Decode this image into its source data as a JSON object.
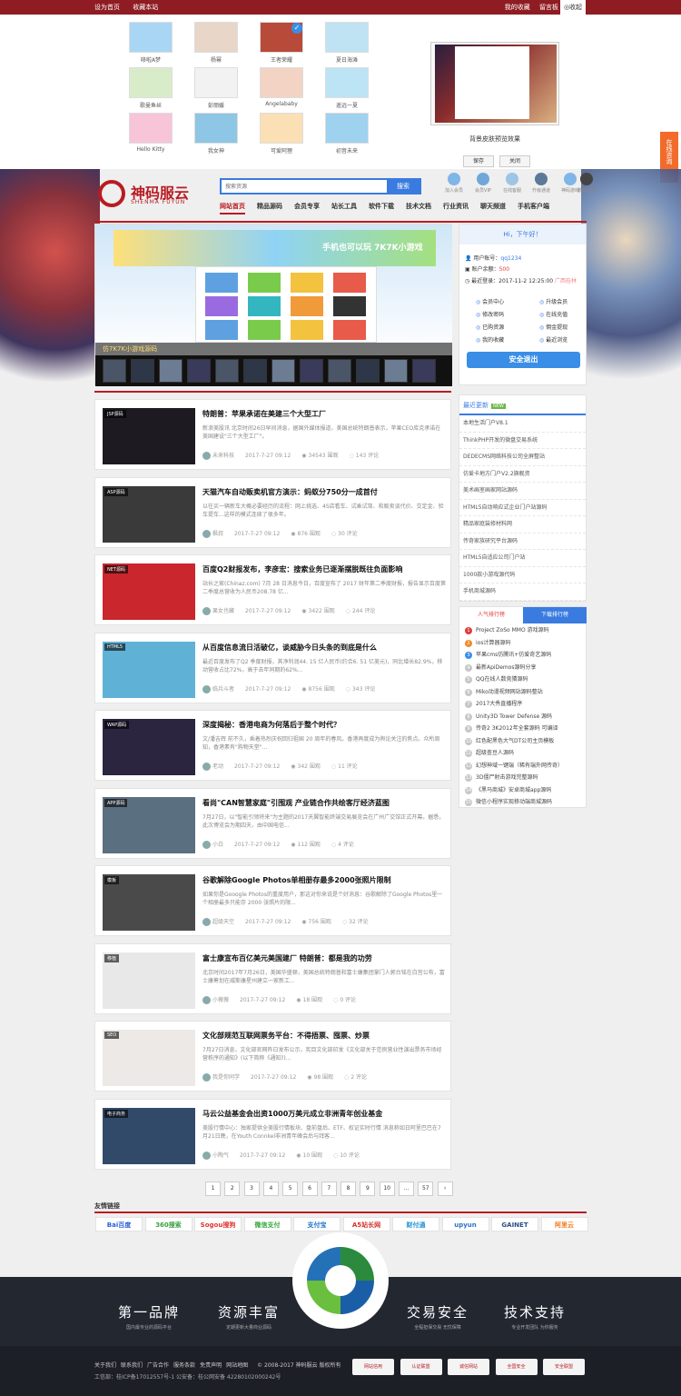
{
  "topbar": {
    "set_home": "设为首页",
    "favorite": "收藏本站",
    "my_favorites": "我的收藏",
    "guestbook": "留言板",
    "fold": "收起"
  },
  "skins": [
    {
      "name": "哆啦A梦",
      "color": "#a9d6f5"
    },
    {
      "name": "杨幂",
      "color": "#e8d6c9"
    },
    {
      "name": "王者荣耀",
      "color": "#b84a3a"
    },
    {
      "name": "夏日海滩",
      "color": "#bfe3f2"
    },
    {
      "name": "歌曼鱼丝",
      "color": "#d9ecc9"
    },
    {
      "name": "彭丽媛",
      "color": "#f2f2f2"
    },
    {
      "name": "Angelababy",
      "color": "#f3d4c4"
    },
    {
      "name": "遥远一夏",
      "color": "#bde4f4"
    },
    {
      "name": "Hello Kitty",
      "color": "#f7c5d7"
    },
    {
      "name": "我女神",
      "color": "#8ec6e6"
    },
    {
      "name": "可爱阿狸",
      "color": "#fbe0b5"
    },
    {
      "name": "初音未来",
      "color": "#9fd2ee"
    }
  ],
  "preview": {
    "caption": "背景皮肤预览效果",
    "save": "保存",
    "close": "关闭"
  },
  "online_consult": "在线咨询",
  "logo": {
    "cn": "神码服云",
    "en": "SHENMA FUYUN"
  },
  "search": {
    "placeholder": "搜索资源",
    "button": "搜索"
  },
  "quick_links": [
    {
      "label": "加入会员",
      "color": "#7fb6e8"
    },
    {
      "label": "会员VIP",
      "color": "#6fa8d8"
    },
    {
      "label": "在线客服",
      "color": "#9ec4e6"
    },
    {
      "label": "升级通道",
      "color": "#5c7a98"
    },
    {
      "label": "神码游戏",
      "color": "#7fb6e8"
    },
    {
      "label": "鹏程资源",
      "color": "#444444"
    }
  ],
  "nav": [
    "网站首页",
    "精品源码",
    "会员专享",
    "站长工具",
    "软件下载",
    "技术文档",
    "行业资讯",
    "聊天频道",
    "手机客户端"
  ],
  "slider": {
    "caption": "仿7K7K小游戏源码",
    "banner": "手机也可以玩 7K7K小游戏"
  },
  "user": {
    "greeting": "Hi，下午好！",
    "account_label": "用户账号：",
    "account": "qq1234",
    "balance_label": "账户余额：",
    "balance": "500",
    "last_login_label": "最近登录：",
    "last_login": "2017-11-2 12:25:00",
    "location": "广西桂林",
    "links": [
      "会员中心",
      "升级会员",
      "修改密码",
      "在线充值",
      "已购资源",
      "佣金提现",
      "我的收藏",
      "最近浏览"
    ],
    "logout": "安全退出"
  },
  "posts": [
    {
      "tag": "JSP源码",
      "title": "特朗普：苹果承诺在美建三个大型工厂",
      "desc": "新浪美股讯 北京时间26日早间消息，据国外媒体报道，美国总统特朗普表示，苹果CEO库克承诺在美国建设\"三个大型工厂\"。",
      "author": "未来科技",
      "date": "2017-7-27 09:12",
      "views": "34543 围观",
      "comments": "143 评论",
      "color": "#1d1a22"
    },
    {
      "tag": "ASP源码",
      "title": "天猫汽车自动贩卖机官方演示：蚂蚁分750分一成首付",
      "desc": "以往买一辆新车大概必要经历的流程：网上挑选、4S店看车、试乘试驾、和贩卖谈代价、交定金、验车提车...这样的模式连续了很多年。",
      "author": "枫叔",
      "date": "2017-7-27 09:12",
      "views": "876 围观",
      "comments": "30 评论",
      "color": "#3a3a3a"
    },
    {
      "tag": "NET源码",
      "title": "百度Q2财报发布，李彦宏：搜索业务已逐渐摆脱既往负面影响",
      "desc": "站长之家(Chinaz.com) 7月 28 日消息今日，百度宣布了 2017 财年第二季度财报，报告显示百度第二季度总营收为人民币208.78 亿...",
      "author": "果女也藏",
      "date": "2017-7-27 09:12",
      "views": "3422 围观",
      "comments": "244 评论",
      "color": "#c9262d"
    },
    {
      "tag": "HTML5",
      "title": "从百度信息流日活破亿，谈威胁今日头条的到底是什么",
      "desc": "最近百度发布了Q2 季度财报，其净利润44. 15 亿人民币(约合6. 51 亿美元)，同比增长82.9%，移动营收占比72%，高于去年同期的62%...",
      "author": "临兵斗者",
      "date": "2017-7-27 09:12",
      "views": "8756 围观",
      "comments": "343 评论",
      "color": "#5fb2d6"
    },
    {
      "tag": "WAP源码",
      "title": "深度揭秘：香港电商为何落后于整个时代？",
      "desc": "文/潘吉辉     前不久，乘着热烈庆祝回归祖国 20 周年的春风，香港再度成为舆论关注的焦点。众所周知，香港素有\"购物天堂\"...",
      "author": "老动",
      "date": "2017-7-27 09:12",
      "views": "342 围观",
      "comments": "11 评论",
      "color": "#2b2540"
    },
    {
      "tag": "APP源码",
      "title": "看尚\"CAN智慧家庭\"引围观 产业链合作共绘客厅经济蓝图",
      "desc": "7月27日，以\"智能引领将来\"为主题的2017天翼智能终端交易展览会在广州广交馆正式开幕。据悉，此次博览会为期四天，由中国电信...",
      "author": "小白",
      "date": "2017-7-27 09:12",
      "views": "112 围观",
      "comments": "4 评论",
      "color": "#5a6f80"
    },
    {
      "tag": "模板",
      "title": "谷歌解除Google Photos单相册存最多2000张照片限制",
      "desc": "如果你是Gooogle Photos的重度用户，那这对你来说是个好消息：谷歌解除了Google Photos里一个相册最多只能存 2000 张照片的限...",
      "author": "超级天空",
      "date": "2017-7-27 09:12",
      "views": "756 围观",
      "comments": "32 评论",
      "color": "#4a4a4a"
    },
    {
      "tag": "移植",
      "title": "富士康宣布百亿美元美国建厂 特朗普：都是我的功劳",
      "desc": "北京时间2017年7月26日，美国华盛顿，美国总统特朗普和富士康集团掌门人郭台铭在白宫公布，富士康筹划在威斯康星州建立一家新工...",
      "author": "小薇薇",
      "date": "2017-7-27 09:12",
      "views": "18 围观",
      "comments": "0 评论",
      "color": "#e8e8e8"
    },
    {
      "tag": "SEO",
      "title": "文化部规范互联网票务平台：不得捂票、囤票、炒票",
      "desc": "7月27日消息，文化部官网昨日发布公示，宪目文化部印发《文化部关于范例营业性演出票务市场经营秩序的通知》(以下简称《通知》)...",
      "author": "我是你同学",
      "date": "2017-7-27 09:12",
      "views": "98 围观",
      "comments": "2 评论",
      "color": "#ece9e6"
    },
    {
      "tag": "电子商务",
      "title": "马云公益基金会出资1000万美元成立非洲青年创业基金",
      "desc": "美股行情中心：独家提供全美股行情板块、盘前盘后、ETF、权证实时行情 消息称如日阿里巴巴在7月21日晚，在Youth Connkel非洲青年峰会后与拜客...",
      "author": "小陶气",
      "date": "2017-7-27 09:12",
      "views": "10 围观",
      "comments": "10 评论",
      "color": "#324a6a"
    }
  ],
  "recent": {
    "title": "最近更新",
    "new_badge": "NEW",
    "items": [
      "本地生活门户V8.1",
      "ThinkPHP开发的微盘交易系统",
      "DEDECMS网络科技公司全屏整站",
      "仿爱卡地方门户V2.2旗舰资",
      "美术画室画家网站源码",
      "HTML5自动响应式企业门户站源码",
      "精品家庭装修材料网",
      "传奇家族研究平台源码",
      "HTML5自适应公司门户站",
      "1000款小游戏源代码",
      "手机商城源码"
    ]
  },
  "ranking": {
    "tab_hot": "人气排行榜",
    "tab_download": "下载排行榜",
    "items": [
      "Project ZoSo MMO 游戏源码",
      "ios计算器源码",
      "苹果cms仿腾讯+仿爱奇艺源码",
      "最新ApiDemos源码分享",
      "QQ在线人数竞猜源码",
      "Miko动漫视频网站源码整站",
      "2017大秀直播程序",
      "Unity3D Tower Defense 源码",
      "传奇2 3K2012年全套源码 可编译",
      "红色配黑色大气DT公司主页模板",
      "超级查豆人源码",
      "幻想神域一键端（稀有端外网传奇）",
      "3D僵尸射击游戏完整源码",
      "《黑马商城》安卓商城app源码",
      "微信小程序实现移动端商城源码"
    ]
  },
  "pager": [
    "1",
    "2",
    "3",
    "4",
    "5",
    "6",
    "7",
    "8",
    "9",
    "10",
    "...",
    "57",
    "›"
  ],
  "friend_links": {
    "title": "友情链接",
    "items": [
      {
        "name": "Bai百度",
        "color": "#2b5fd9"
      },
      {
        "name": "360搜索",
        "color": "#3aa142"
      },
      {
        "name": "Sogou搜狗",
        "color": "#e0342c"
      },
      {
        "name": "微信支付",
        "color": "#35a83a"
      },
      {
        "name": "支付宝",
        "color": "#1a73c9"
      },
      {
        "name": "A5站长网",
        "color": "#d2312b"
      },
      {
        "name": "财付通",
        "color": "#1d8fd6"
      },
      {
        "name": "upyun",
        "color": "#2e73c5"
      },
      {
        "name": "GAINET",
        "color": "#2a4f84"
      },
      {
        "name": "阿里云",
        "color": "#f17b1f"
      }
    ]
  },
  "features": [
    {
      "title": "第一品牌",
      "desc": "国内最专业的源码平台"
    },
    {
      "title": "资源丰富",
      "desc": "定期更新大量商业源码"
    },
    {
      "title": "交易安全",
      "desc": "全程担保交易 无忧保障"
    },
    {
      "title": "技术支持",
      "desc": "专业开发团队 为你服务"
    }
  ],
  "footer": {
    "links": [
      "关于我们",
      "联系我们",
      "广告合作",
      "服务条款",
      "免责声明",
      "网站地图"
    ],
    "copyright": "© 2008-2017 神码服云 版权所有",
    "icp": "工信部：桂ICP备17012557号-1 公安备：桂公网安备 42280102000242号",
    "certs": [
      "网站信用",
      "认证联盟",
      "诚信网站",
      "全国安全",
      "安全联盟"
    ]
  }
}
